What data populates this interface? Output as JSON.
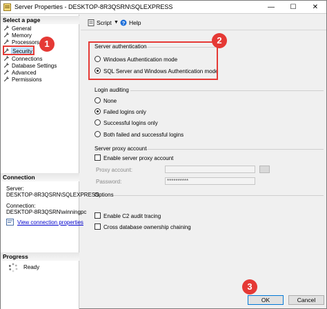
{
  "window": {
    "title": "Server Properties - DESKTOP-8R3QSRN\\SQLEXPRESS",
    "minimize": "—",
    "maximize": "☐",
    "close": "✕"
  },
  "left": {
    "select_page_heading": "Select a page",
    "pages": [
      {
        "label": "General"
      },
      {
        "label": "Memory"
      },
      {
        "label": "Processors"
      },
      {
        "label": "Security"
      },
      {
        "label": "Connections"
      },
      {
        "label": "Database Settings"
      },
      {
        "label": "Advanced"
      },
      {
        "label": "Permissions"
      }
    ],
    "connection_heading": "Connection",
    "server_label": "Server:",
    "server_value": "DESKTOP-8R3QSRN\\SQLEXPRESS",
    "connection_label": "Connection:",
    "connection_value": "DESKTOP-8R3QSRN\\winningpc",
    "view_link": "View connection properties",
    "progress_heading": "Progress",
    "progress_status": "Ready"
  },
  "toolbar": {
    "script_label": "Script",
    "help_label": "Help"
  },
  "server_auth": {
    "title": "Server authentication",
    "options": [
      "Windows Authentication mode",
      "SQL Server and Windows Authentication mode"
    ],
    "selected": 1
  },
  "login_auditing": {
    "title": "Login auditing",
    "options": [
      "None",
      "Failed logins only",
      "Successful logins only",
      "Both failed and successful logins"
    ],
    "selected": 1
  },
  "proxy": {
    "title": "Server proxy account",
    "enable_label": "Enable server proxy account",
    "account_label": "Proxy account:",
    "account_value": "",
    "password_label": "Password:",
    "password_value": "**********"
  },
  "options": {
    "title": "Options",
    "c2_label": "Enable C2 audit tracing",
    "cross_db_label": "Cross database ownership chaining"
  },
  "buttons": {
    "ok": "OK",
    "cancel": "Cancel"
  },
  "annotations": {
    "one": "1",
    "two": "2",
    "three": "3"
  },
  "colors": {
    "highlight_red": "#e53935",
    "selection_blue": "#cce8ff",
    "link_blue": "#0000cc"
  }
}
